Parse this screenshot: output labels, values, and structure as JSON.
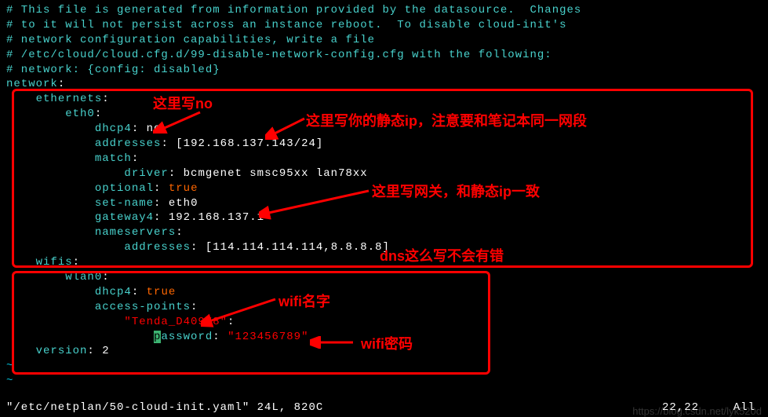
{
  "comments": {
    "c1": "# This file is generated from information provided by the datasource.  Changes",
    "c2": "# to it will not persist across an instance reboot.  To disable cloud-init's",
    "c3": "# network configuration capabilities, write a file",
    "c4": "# /etc/cloud/cloud.cfg.d/99-disable-network-config.cfg with the following:",
    "c5": "# network: {config: disabled}"
  },
  "yaml": {
    "network": "network",
    "ethernets": "ethernets",
    "eth0": "eth0",
    "dhcp4": "dhcp4",
    "dhcp4_val_no": "no",
    "addresses": "addresses",
    "addr_br_open": "[",
    "addr_val": "192.168.137.143/24",
    "addr_br_close": "]",
    "match": "match",
    "driver": "driver",
    "driver_val": "bcmgenet smsc95xx lan78xx",
    "optional": "optional",
    "true": "true",
    "setname": "set-name",
    "setname_val": "eth0",
    "gateway4": "gateway4",
    "gateway4_val": "192.168.137.1",
    "nameservers": "nameservers",
    "ns_addresses": "addresses",
    "ns_val": "114.114.114.114,8.8.8.8",
    "wifis": "wifis",
    "wlan0": "wlan0",
    "dhcp4_val_true": "true",
    "access_points": "access-points",
    "ssid": "\"Tenda_D40978\"",
    "password_key": "assword",
    "password_key_first": "p",
    "password_val": "\"123456789\"",
    "version": "version",
    "version_val": "2"
  },
  "annotations": {
    "a1": "这里写no",
    "a2": "这里写你的静态ip，注意要和笔记本同一网段",
    "a3": "这里写网关，和静态ip一致",
    "a4": "dns这么写不会有错",
    "a5": "wifi名字",
    "a6": "wifi密码"
  },
  "status": {
    "file": "\"/etc/netplan/50-cloud-init.yaml\" 24L, 820C",
    "pos": "22,22",
    "all": "All"
  },
  "watermark": "https://blog.csdn.net/lyk520d"
}
